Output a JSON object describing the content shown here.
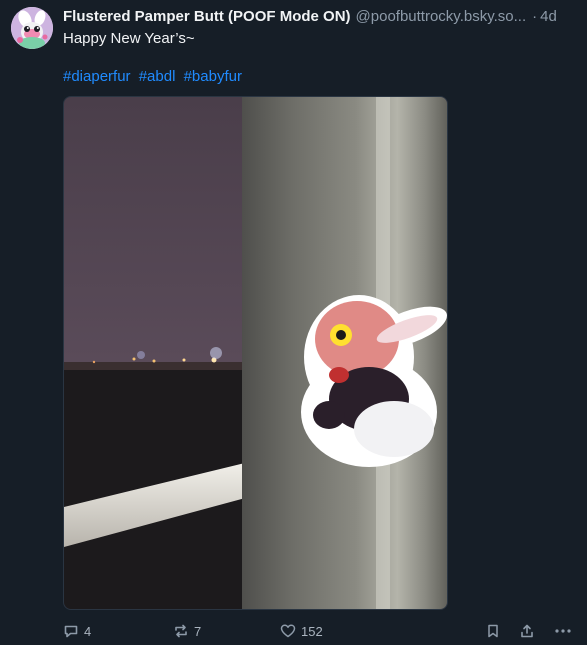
{
  "post": {
    "display_name": "Flustered Pamper Butt (POOF Mode ON)",
    "handle": "@poofbuttrocky.bsky.so...",
    "time_separator": "·",
    "timestamp": "4d",
    "text": "Happy New Year’s~",
    "hashtags": [
      "#diaperfur",
      "#abdl",
      "#babyfur"
    ]
  },
  "actions": {
    "reply_count": "4",
    "repost_count": "7",
    "like_count": "152"
  },
  "colors": {
    "background": "#161e27",
    "link": "#208bfe",
    "muted": "#8d9aa8"
  },
  "icons": [
    "avatar",
    "reply-icon",
    "repost-icon",
    "like-icon",
    "bookmark-icon",
    "share-icon",
    "more-icon"
  ]
}
